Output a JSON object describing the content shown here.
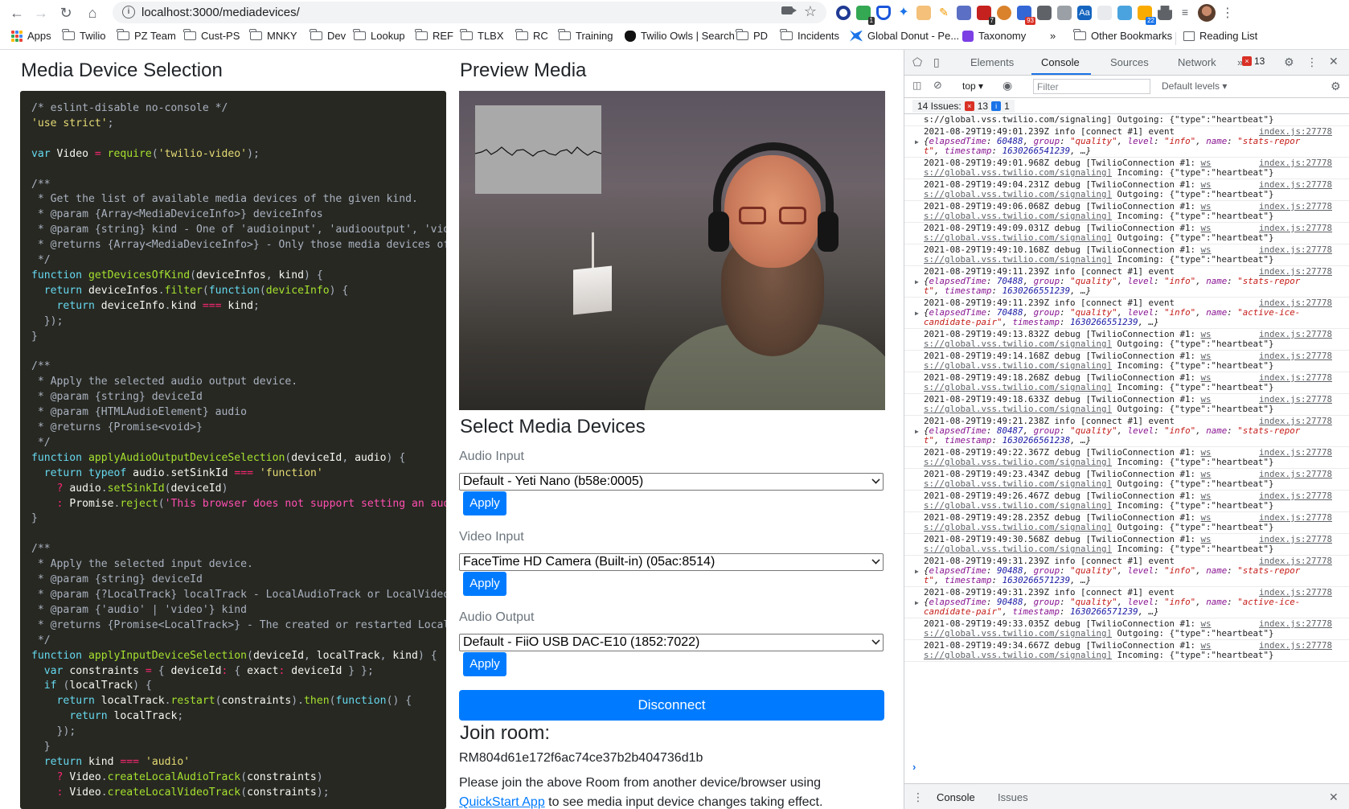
{
  "browser": {
    "url": "localhost:3000/mediadevices/",
    "extension_badges": [
      "1",
      "7",
      "93",
      "22"
    ],
    "bookmarks": [
      {
        "label": "Apps",
        "icon": "apps-grid-icon"
      },
      {
        "label": "Twilio",
        "icon": "folder-icon"
      },
      {
        "label": "PZ Team",
        "icon": "folder-icon"
      },
      {
        "label": "Cust-PS",
        "icon": "folder-icon"
      },
      {
        "label": "MNKY",
        "icon": "folder-icon"
      },
      {
        "label": "Dev",
        "icon": "folder-icon"
      },
      {
        "label": "Lookup",
        "icon": "folder-icon"
      },
      {
        "label": "REF",
        "icon": "folder-icon"
      },
      {
        "label": "TLBX",
        "icon": "folder-icon"
      },
      {
        "label": "RC",
        "icon": "folder-icon"
      },
      {
        "label": "Training",
        "icon": "folder-icon"
      },
      {
        "label": "Twilio Owls | Search",
        "icon": "owl-icon"
      },
      {
        "label": "PD",
        "icon": "folder-icon"
      },
      {
        "label": "Incidents",
        "icon": "folder-icon"
      },
      {
        "label": "Global Donut - Pe...",
        "icon": "donut-icon"
      },
      {
        "label": "Taxonomy",
        "icon": "taxonomy-icon"
      }
    ],
    "overflow_label": "»",
    "other_bookmarks": "Other Bookmarks",
    "reading_list": "Reading List"
  },
  "left": {
    "title": "Media Device Selection"
  },
  "preview": {
    "title": "Preview Media",
    "select_title": "Select Media Devices",
    "audio_input_label": "Audio Input",
    "audio_input_value": "Default - Yeti Nano (b58e:0005)",
    "video_input_label": "Video Input",
    "video_input_value": "FaceTime HD Camera (Built-in) (05ac:8514)",
    "audio_output_label": "Audio Output",
    "audio_output_value": "Default - FiiO USB DAC-E10 (1852:7022)",
    "apply_label": "Apply",
    "disconnect_label": "Disconnect",
    "join_title": "Join room:",
    "room_id": "RM804d61e172f6ac74ce37b2b404736d1b",
    "note_before": "Please join the above Room from another device/browser using",
    "note_link": "QuickStart App",
    "note_after": "to see media input device changes taking effect."
  },
  "devtools": {
    "tabs": [
      "Elements",
      "Console",
      "Sources",
      "Network"
    ],
    "active_tab": "Console",
    "more_tabs": "»",
    "error_count": "13",
    "context": "top",
    "filter_placeholder": "Filter",
    "levels": "Default levels",
    "issues_label": "14 Issues:",
    "issues_errors": "13",
    "issues_info": "1",
    "bottom_tabs": [
      "Console",
      "Issues"
    ],
    "log_first_line": "s://global.vss.twilio.com/signaling] Outgoing: {\"type\":\"heartbeat\"}",
    "logs": [
      {
        "kind": "event",
        "ts": "2021-08-29T19:49:01.239Z",
        "elapsed": "60488",
        "name": "stats-repor",
        "name_wrap": "t",
        "timestamp": "1630266541239"
      },
      {
        "kind": "hb",
        "ts": "2021-08-29T19:49:01.968Z",
        "dir": "Incoming"
      },
      {
        "kind": "hb",
        "ts": "2021-08-29T19:49:04.231Z",
        "dir": "Outgoing"
      },
      {
        "kind": "hb",
        "ts": "2021-08-29T19:49:06.068Z",
        "dir": "Incoming"
      },
      {
        "kind": "hb",
        "ts": "2021-08-29T19:49:09.031Z",
        "dir": "Outgoing"
      },
      {
        "kind": "hb",
        "ts": "2021-08-29T19:49:10.168Z",
        "dir": "Incoming"
      },
      {
        "kind": "event",
        "ts": "2021-08-29T19:49:11.239Z",
        "elapsed": "70488",
        "name": "stats-repor",
        "name_wrap": "t",
        "timestamp": "1630266551239"
      },
      {
        "kind": "event2",
        "ts": "2021-08-29T19:49:11.239Z",
        "elapsed": "70488",
        "name": "active-ice-",
        "name_wrap": "candidate-pair",
        "timestamp": "1630266551239"
      },
      {
        "kind": "hb",
        "ts": "2021-08-29T19:49:13.832Z",
        "dir": "Outgoing"
      },
      {
        "kind": "hb",
        "ts": "2021-08-29T19:49:14.168Z",
        "dir": "Incoming"
      },
      {
        "kind": "hb",
        "ts": "2021-08-29T19:49:18.268Z",
        "dir": "Incoming"
      },
      {
        "kind": "hb",
        "ts": "2021-08-29T19:49:18.633Z",
        "dir": "Outgoing"
      },
      {
        "kind": "event",
        "ts": "2021-08-29T19:49:21.238Z",
        "elapsed": "80487",
        "name": "stats-repor",
        "name_wrap": "t",
        "timestamp": "1630266561238"
      },
      {
        "kind": "hb",
        "ts": "2021-08-29T19:49:22.367Z",
        "dir": "Incoming"
      },
      {
        "kind": "hb",
        "ts": "2021-08-29T19:49:23.434Z",
        "dir": "Outgoing"
      },
      {
        "kind": "hb",
        "ts": "2021-08-29T19:49:26.467Z",
        "dir": "Incoming"
      },
      {
        "kind": "hb",
        "ts": "2021-08-29T19:49:28.235Z",
        "dir": "Outgoing"
      },
      {
        "kind": "hb",
        "ts": "2021-08-29T19:49:30.568Z",
        "dir": "Incoming"
      },
      {
        "kind": "event",
        "ts": "2021-08-29T19:49:31.239Z",
        "elapsed": "90488",
        "name": "stats-repor",
        "name_wrap": "t",
        "timestamp": "1630266571239"
      },
      {
        "kind": "event2",
        "ts": "2021-08-29T19:49:31.239Z",
        "elapsed": "90488",
        "name": "active-ice-",
        "name_wrap": "candidate-pair",
        "timestamp": "1630266571239"
      },
      {
        "kind": "hb",
        "ts": "2021-08-29T19:49:33.035Z",
        "dir": "Outgoing"
      },
      {
        "kind": "hb",
        "ts": "2021-08-29T19:49:34.667Z",
        "dir": "Incoming"
      }
    ],
    "log_source": "index.js:27778",
    "log_level_info": "info",
    "log_level_debug": "debug",
    "connect_tag": "[connect #1] event",
    "conn_tag": "[TwilioConnection #1:",
    "ws_link": "ws",
    "ws_url": "s://global.vss.twilio.com/signaling]",
    "heartbeat": "{\"type\":\"heartbeat\"}"
  },
  "code_lines": [
    "/* eslint-disable no-console */",
    "'use strict';",
    "",
    "var Video = require('twilio-video');",
    "",
    "/**",
    " * Get the list of available media devices of the given kind.",
    " * @param {Array<MediaDeviceInfo>} deviceInfos",
    " * @param {string} kind - One of 'audioinput', 'audiooutput', 'videoinput'",
    " * @returns {Array<MediaDeviceInfo>} - Only those media devices of the given kind",
    " */",
    "function getDevicesOfKind(deviceInfos, kind) {",
    "  return deviceInfos.filter(function(deviceInfo) {",
    "    return deviceInfo.kind === kind;",
    "  });",
    "}",
    "",
    "/**",
    " * Apply the selected audio output device.",
    " * @param {string} deviceId",
    " * @param {HTMLAudioElement} audio",
    " * @returns {Promise<void>}",
    " */",
    "function applyAudioOutputDeviceSelection(deviceId, audio) {",
    "  return typeof audio.setSinkId === 'function'",
    "    ? audio.setSinkId(deviceId)",
    "    : Promise.reject('This browser does not support setting an audio output device');",
    "}",
    "",
    "/**",
    " * Apply the selected input device.",
    " * @param {string} deviceId",
    " * @param {?LocalTrack} localTrack - LocalAudioTrack or LocalVideoTrack",
    " * @param {'audio' | 'video'} kind",
    " * @returns {Promise<LocalTrack>} - The created or restarted LocalTrack",
    " */",
    "function applyInputDeviceSelection(deviceId, localTrack, kind) {",
    "  var constraints = { deviceId: { exact: deviceId } };",
    "  if (localTrack) {",
    "    return localTrack.restart(constraints).then(function() {",
    "      return localTrack;",
    "    });",
    "  }",
    "  return kind === 'audio'",
    "    ? Video.createLocalAudioTrack(constraints)",
    "    : Video.createLocalVideoTrack(constraints);"
  ]
}
